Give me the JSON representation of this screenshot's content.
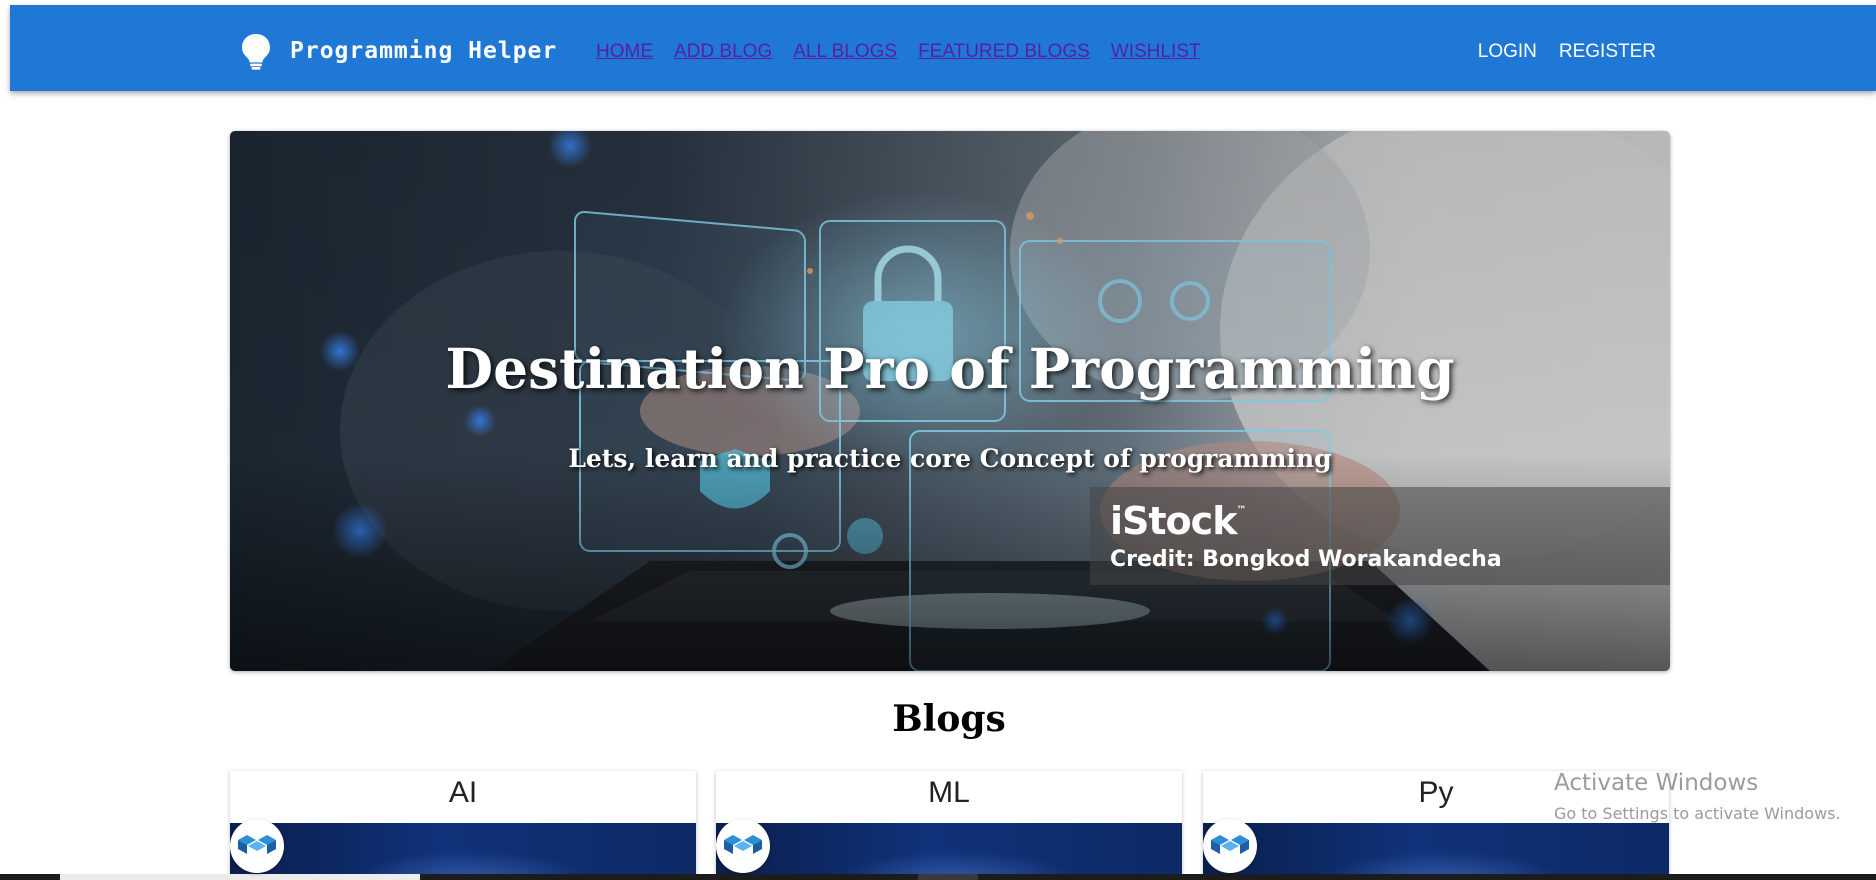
{
  "navbar": {
    "brand": "Programming Helper",
    "brand_icon": "lightbulb-icon",
    "background": "#1f78d6",
    "links": [
      {
        "label": "HOME"
      },
      {
        "label": "ADD BLOG"
      },
      {
        "label": "ALL BLOGS"
      },
      {
        "label": "FEATURED BLOGS"
      },
      {
        "label": "WISHLIST"
      }
    ],
    "login": "LOGIN",
    "register": "REGISTER"
  },
  "hero": {
    "title": "Destination Pro of Programming",
    "subtitle": "Lets, learn and practice core Concept of programming",
    "credit_brand": "iStock",
    "credit_tm": "™",
    "credit_line": "Credit: Bongkod Worakandecha"
  },
  "blogs": {
    "heading": "Blogs",
    "cards": [
      {
        "title": "AI"
      },
      {
        "title": "ML"
      },
      {
        "title": "Py"
      }
    ]
  },
  "windows_watermark": {
    "title": "Activate Windows",
    "hint": "Go to Settings to activate Windows."
  }
}
